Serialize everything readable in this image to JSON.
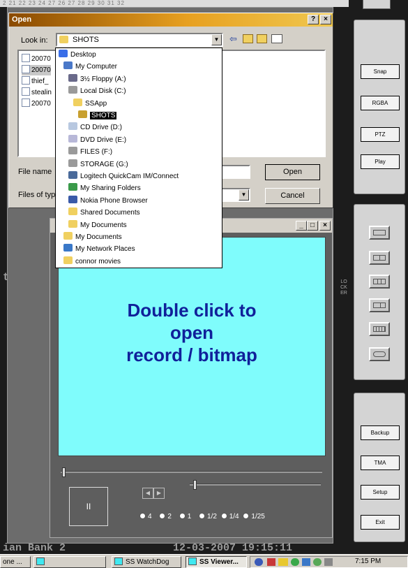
{
  "ruler_text": "2 21 22 23 24 27 26 27 28 29 30 31 32",
  "background": {
    "store_text": "tore_r",
    "bottom_left": "ian Bank 2",
    "bottom_right": "12-03-2007 19:15:11",
    "locker_label": "LOCKER"
  },
  "right_panel": {
    "buttons": [
      "Snap",
      "RGBA",
      "PTZ",
      "Play"
    ],
    "layout_names": [
      "single",
      "quad",
      "six",
      "split",
      "grid-16",
      "cycle"
    ],
    "buttons2": [
      "Backup",
      "TMA",
      "Setup",
      "Exit"
    ]
  },
  "viewer": {
    "message_lines": [
      "Double click to",
      "open",
      "record / bitmap"
    ],
    "pause_label": "II",
    "step_back": "◀",
    "step_fwd": "▶",
    "speeds": [
      "4",
      "2",
      "1",
      "1/2",
      "1/4",
      "1/25"
    ],
    "min": "_",
    "max": "□",
    "close": "×"
  },
  "dialog": {
    "title": "Open",
    "help": "?",
    "close": "×",
    "look_in_label": "Look in:",
    "look_in_value": "SHOTS",
    "file_name_label": "File name",
    "files_of_type_label": "Files of typ",
    "open_button": "Open",
    "cancel_button": "Cancel",
    "files": [
      "20070",
      "20070",
      "thief_",
      "stealin",
      "20070"
    ],
    "dropdown": [
      {
        "label": "Desktop",
        "icon": "desktop-icon",
        "indent": 0,
        "color": "#3a6ee8"
      },
      {
        "label": "My Computer",
        "icon": "computer-icon",
        "indent": 1,
        "color": "#4a78c8"
      },
      {
        "label": "3½ Floppy (A:)",
        "icon": "floppy-icon",
        "indent": 2,
        "color": "#6a6a8a"
      },
      {
        "label": "Local Disk (C:)",
        "icon": "disk-icon",
        "indent": 2,
        "color": "#9a9a9a"
      },
      {
        "label": "SSApp",
        "icon": "folder-icon",
        "indent": 3,
        "color": "#f0d060"
      },
      {
        "label": "SHOTS",
        "icon": "open-folder-icon",
        "indent": 4,
        "color": "#c8a030",
        "selected": true
      },
      {
        "label": "CD Drive (D:)",
        "icon": "cd-icon",
        "indent": 2,
        "color": "#b8c8e0"
      },
      {
        "label": "DVD Drive (E:)",
        "icon": "dvd-icon",
        "indent": 2,
        "color": "#b8b8d8"
      },
      {
        "label": "FILES (F:)",
        "icon": "drive-icon",
        "indent": 2,
        "color": "#9a9a9a"
      },
      {
        "label": "STORAGE (G:)",
        "icon": "drive-icon",
        "indent": 2,
        "color": "#9a9a9a"
      },
      {
        "label": "Logitech QuickCam IM/Connect",
        "icon": "webcam-icon",
        "indent": 2,
        "color": "#4a6a9a"
      },
      {
        "label": "My Sharing Folders",
        "icon": "sharing-icon",
        "indent": 2,
        "color": "#3a9a4a"
      },
      {
        "label": "Nokia Phone Browser",
        "icon": "phone-icon",
        "indent": 2,
        "color": "#3a5aa8"
      },
      {
        "label": "Shared Documents",
        "icon": "folder-icon",
        "indent": 2,
        "color": "#f0d060"
      },
      {
        "label": "My Documents",
        "icon": "folder-icon",
        "indent": 2,
        "color": "#f0d060"
      },
      {
        "label": "My Documents",
        "icon": "documents-icon",
        "indent": 1,
        "color": "#f0d060"
      },
      {
        "label": "My Network Places",
        "icon": "network-icon",
        "indent": 1,
        "color": "#3a78c8"
      },
      {
        "label": "connor movies",
        "icon": "folder-icon",
        "indent": 1,
        "color": "#f0d060"
      }
    ]
  },
  "taskbar": {
    "items": [
      {
        "label": "one ...",
        "active": false
      },
      {
        "label": "",
        "active": false
      },
      {
        "label": "SS WatchDog",
        "active": false
      },
      {
        "label": "SS Viewer...",
        "active": true
      }
    ],
    "clock": "7:15 PM"
  }
}
